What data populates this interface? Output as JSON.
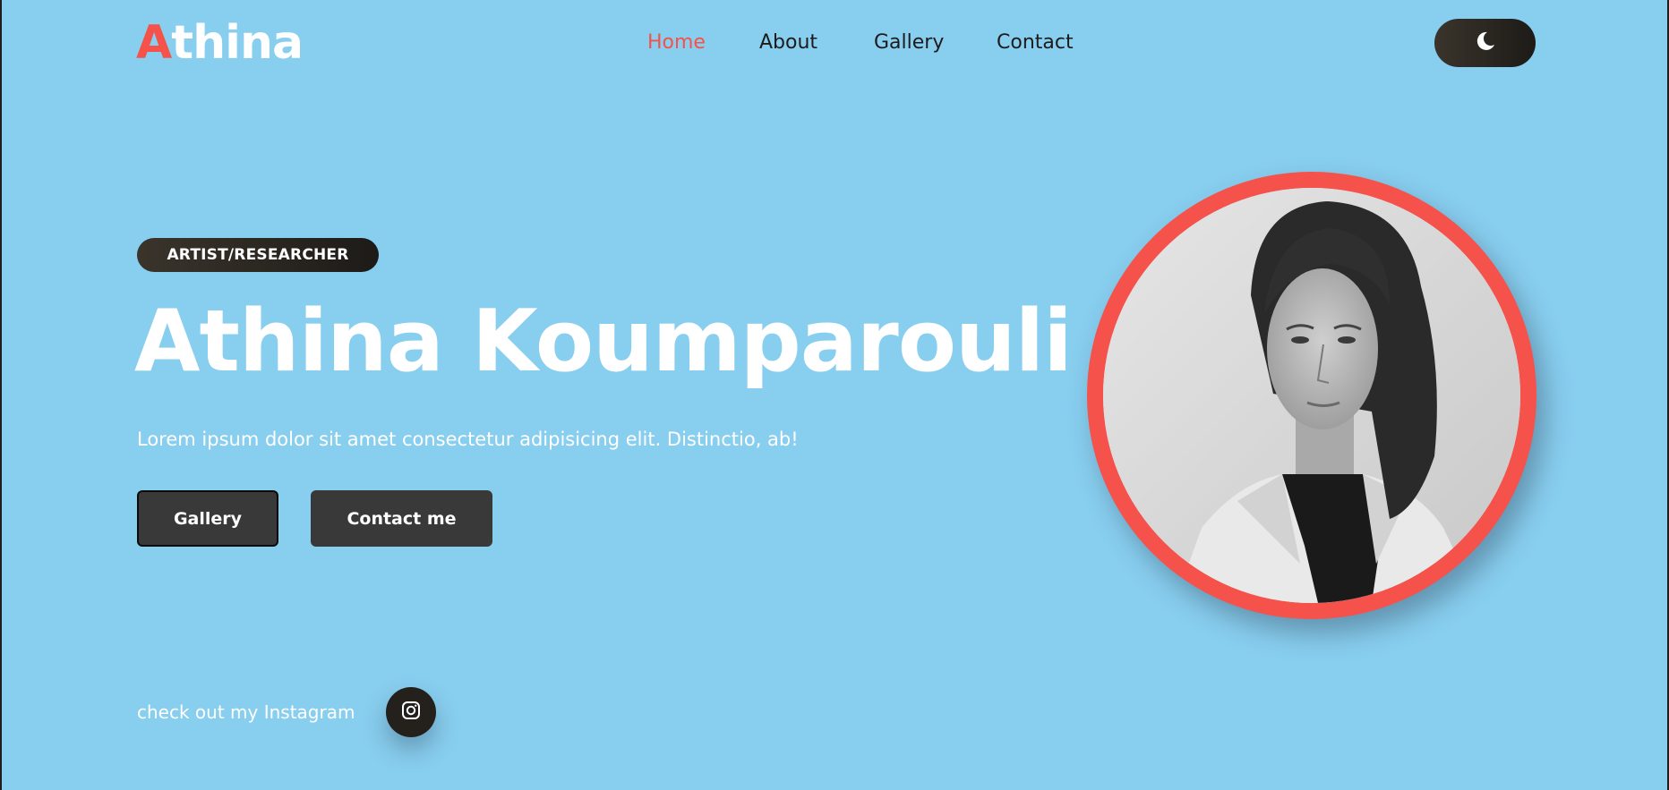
{
  "header": {
    "logo_first": "A",
    "logo_rest": "thina",
    "nav": [
      {
        "label": "Home",
        "active": true
      },
      {
        "label": "About",
        "active": false
      },
      {
        "label": "Gallery",
        "active": false
      },
      {
        "label": "Contact",
        "active": false
      }
    ],
    "theme_toggle_icon": "moon-icon"
  },
  "hero": {
    "badge": "ARTIST/RESEARCHER",
    "title": "Athina Koumparouli",
    "description": "Lorem ipsum dolor sit amet consectetur adipisicing elit. Distinctio, ab!",
    "gallery_button": "Gallery",
    "contact_button": "Contact me",
    "instagram_text": "check out my Instagram",
    "instagram_icon": "instagram-icon"
  },
  "colors": {
    "background": "#88ceef",
    "accent": "#f5524b",
    "dark": "#393939"
  }
}
